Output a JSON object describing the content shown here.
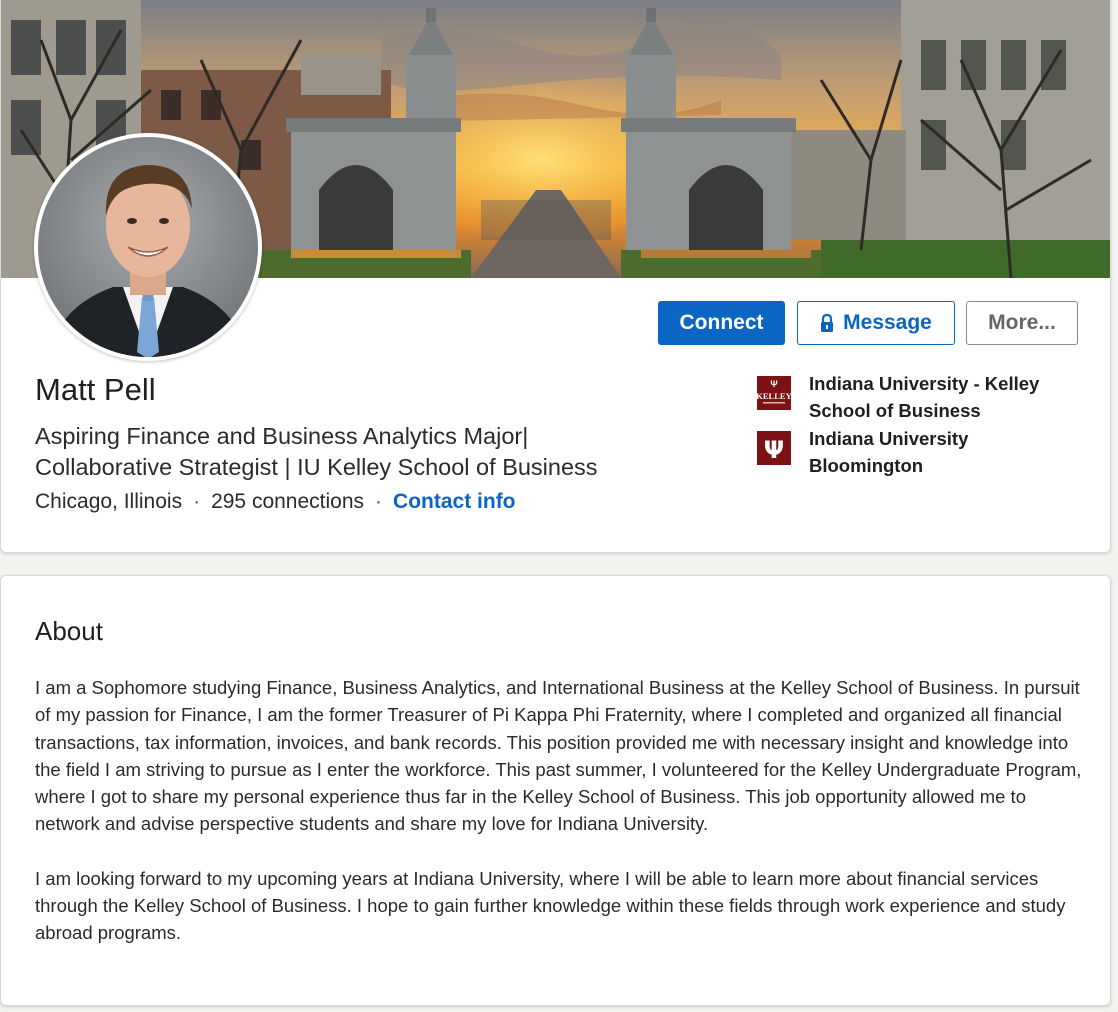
{
  "profile": {
    "name": "Matt Pell",
    "headline_line1": "Aspiring Finance and Business Analytics Major|",
    "headline_line2": "Collaborative Strategist | IU Kelley School of Business",
    "location": "Chicago, Illinois",
    "separator": "·",
    "connections": "295 connections",
    "contact_info": "Contact info",
    "banner_icon": "campus-gates-banner",
    "avatar_icon": "profile-photo"
  },
  "actions": {
    "connect_label": "Connect",
    "message_label": "Message",
    "message_icon": "lock-icon",
    "more_label": "More..."
  },
  "education": [
    {
      "name": "Indiana University - Kelley School of Business",
      "logo_text": "KELLEY",
      "logo_icon": "kelley-logo-icon"
    },
    {
      "name": "Indiana University Bloomington",
      "logo_text": "Ψ",
      "logo_icon": "iu-trident-icon"
    }
  ],
  "about": {
    "title": "About",
    "paragraph1": "I am a Sophomore studying Finance, Business Analytics, and International Business at the Kelley School of Business. In pursuit of my passion for Finance, I am the former Treasurer of Pi Kappa Phi Fraternity, where I completed and organized all financial transactions, tax information, invoices, and bank records. This position provided me with necessary insight and knowledge into the field I am striving to pursue as I enter the workforce. This past summer, I volunteered for the Kelley Undergraduate Program, where I got to share my personal experience thus far in the Kelley School of Business. This job opportunity allowed me to network and advise perspective students and share my love for Indiana University.",
    "paragraph2": "I am looking forward to my upcoming years at Indiana University, where I will be able to learn more about financial services through the Kelley School of Business. I hope to gain further knowledge within these fields through work experience and study abroad programs."
  },
  "colors": {
    "accent": "#0a66c2",
    "iu_crimson": "#7d1214",
    "card_bg": "#ffffff",
    "page_bg": "#f3f2ef"
  }
}
